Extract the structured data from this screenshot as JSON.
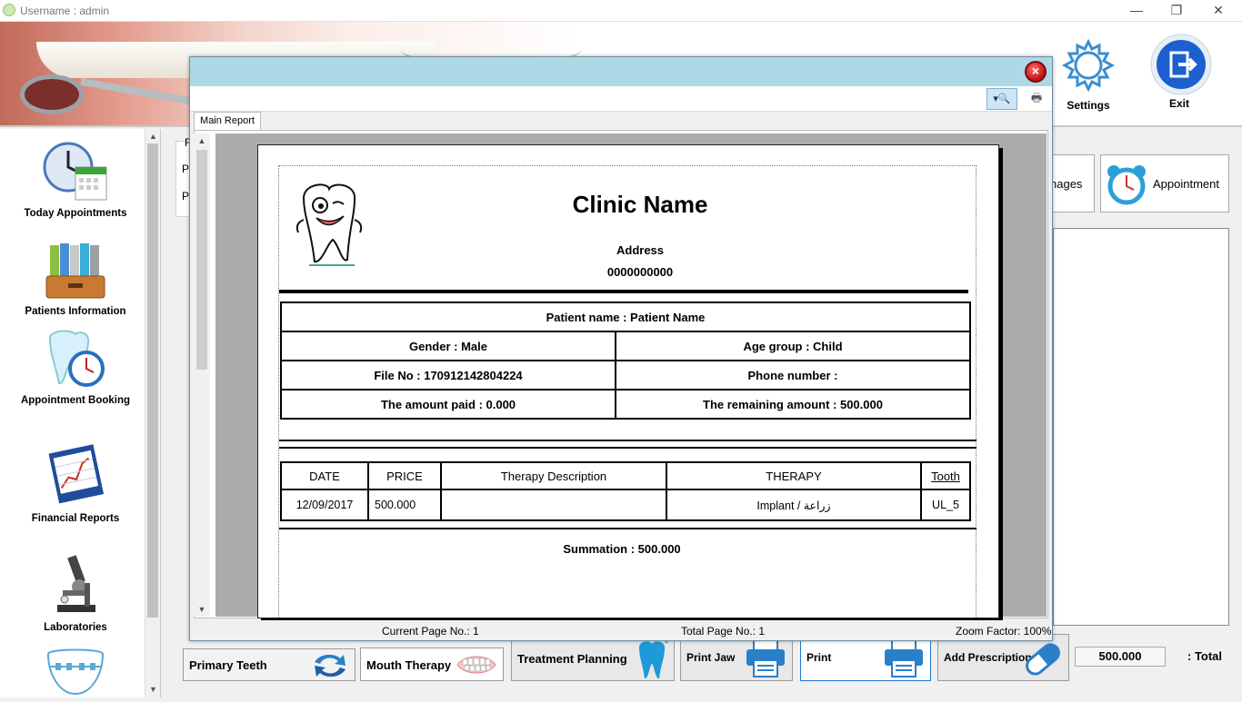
{
  "window": {
    "title": "Username : admin",
    "controls": {
      "minimize": "—",
      "restore": "❐",
      "close": "✕"
    }
  },
  "top_buttons": {
    "settings": "Settings",
    "exit": "Exit"
  },
  "sidebar": {
    "items": [
      {
        "label": "Today Appointments",
        "icon": "calendar-clock-icon"
      },
      {
        "label": "Patients Information",
        "icon": "binders-icon"
      },
      {
        "label": "Appointment Booking",
        "icon": "tooth-clock-icon"
      },
      {
        "label": "Financial Reports",
        "icon": "report-chart-icon"
      },
      {
        "label": "Laboratories",
        "icon": "microscope-icon"
      },
      {
        "label": "",
        "icon": "braces-icon"
      }
    ]
  },
  "main": {
    "group_letters": [
      "F",
      "P",
      "P"
    ],
    "right_buttons": {
      "images": "nages",
      "appointment": "Appointment"
    }
  },
  "bottom_buttons": [
    {
      "label": "Primary Teeth",
      "icon": "swap-arrows-icon"
    },
    {
      "label": "Mouth Therapy",
      "icon": "teeth-icon"
    },
    {
      "label": "Treatment Planning",
      "icon": "tooth-icon"
    },
    {
      "label": "Print Jaw",
      "icon": "printer-icon"
    },
    {
      "label": "Print",
      "icon": "printer-icon"
    },
    {
      "label": "Add Prescription",
      "icon": "capsule-icon"
    }
  ],
  "total": {
    "value": "500.000",
    "label": ": Total"
  },
  "report_window": {
    "tab": "Main Report",
    "zoom_icon": "zoom-in-icon",
    "status": {
      "current_page": "Current Page No.: 1",
      "total_pages": "Total Page No.: 1",
      "zoom": "Zoom Factor: 100%"
    }
  },
  "report": {
    "clinic_name": "Clinic Name",
    "address": "Address",
    "phone": "0000000000",
    "patient_name": "Patient name : Patient   Name",
    "gender": "Gender : Male",
    "age_group": "Age group : Child",
    "file_no": "File No : 170912142804224",
    "phone_number": "Phone number :",
    "amount_paid": "The amount paid : 0.000",
    "remaining_amount": "The remaining amount : 500.000",
    "therapy_table": {
      "headers": [
        "DATE",
        "PRICE",
        "Therapy Description",
        "THERAPY",
        "Tooth"
      ],
      "rows": [
        [
          "12/09/2017",
          "500.000",
          "",
          "Implant / زراعة",
          "UL_5"
        ]
      ]
    },
    "summation": "Summation : 500.000"
  }
}
